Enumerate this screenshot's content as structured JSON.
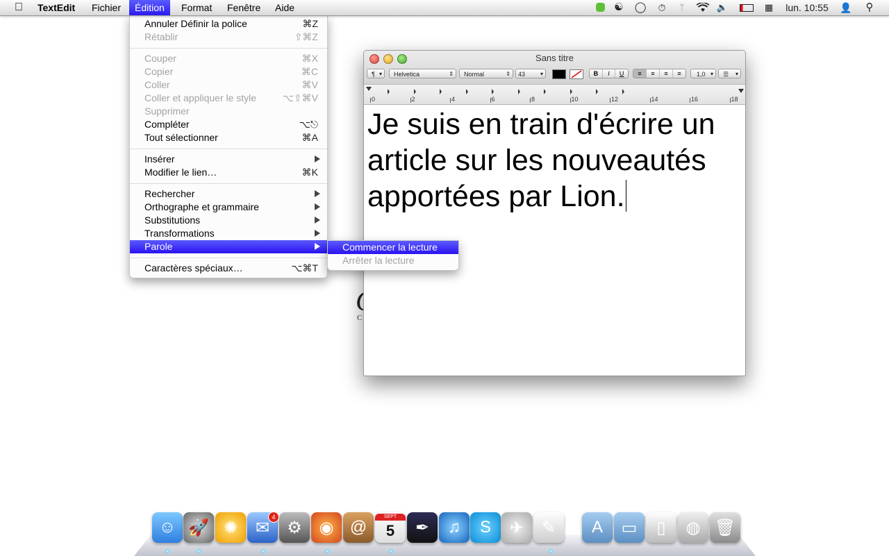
{
  "menubar": {
    "app_name": "TextEdit",
    "menus": [
      "Fichier",
      "Édition",
      "Format",
      "Fenêtre",
      "Aide"
    ],
    "clock": "lun. 10:55"
  },
  "edit_menu": {
    "groups": [
      [
        {
          "label": "Annuler Définir la police",
          "shortcut": "⌘Z",
          "enabled": true
        },
        {
          "label": "Rétablir",
          "shortcut": "⇧⌘Z",
          "enabled": false
        }
      ],
      [
        {
          "label": "Couper",
          "shortcut": "⌘X",
          "enabled": false
        },
        {
          "label": "Copier",
          "shortcut": "⌘C",
          "enabled": false
        },
        {
          "label": "Coller",
          "shortcut": "⌘V",
          "enabled": false
        },
        {
          "label": "Coller et appliquer le style",
          "shortcut": "⌥⇧⌘V",
          "enabled": false
        },
        {
          "label": "Supprimer",
          "shortcut": "",
          "enabled": false
        },
        {
          "label": "Compléter",
          "shortcut": "⌥⎋",
          "enabled": true
        },
        {
          "label": "Tout sélectionner",
          "shortcut": "⌘A",
          "enabled": true
        }
      ],
      [
        {
          "label": "Insérer",
          "submenu": true,
          "enabled": true
        },
        {
          "label": "Modifier le lien…",
          "shortcut": "⌘K",
          "enabled": true
        }
      ],
      [
        {
          "label": "Rechercher",
          "submenu": true,
          "enabled": true
        },
        {
          "label": "Orthographe et grammaire",
          "submenu": true,
          "enabled": true
        },
        {
          "label": "Substitutions",
          "submenu": true,
          "enabled": true
        },
        {
          "label": "Transformations",
          "submenu": true,
          "enabled": true
        },
        {
          "label": "Parole",
          "submenu": true,
          "enabled": true,
          "highlighted": true
        }
      ],
      [
        {
          "label": "Caractères spéciaux…",
          "shortcut": "⌥⌘T",
          "enabled": true
        }
      ]
    ]
  },
  "speech_submenu": {
    "items": [
      {
        "label": "Commencer la lecture",
        "enabled": true,
        "highlighted": true
      },
      {
        "label": "Arrêter la lecture",
        "enabled": false
      }
    ]
  },
  "window": {
    "title": "Sans titre",
    "toolbar": {
      "paragraph": "¶",
      "font": "Helvetica",
      "style": "Normal",
      "size": "43",
      "bold": "B",
      "italic": "I",
      "underline": "U",
      "spacing": "1,0",
      "text_color": "#000000"
    },
    "ruler_numbers": [
      "0",
      "2",
      "4",
      "6",
      "8",
      "10",
      "12",
      "14",
      "16",
      "18"
    ],
    "body_text": "Je suis en train d'écrire un article sur les nouveautés apportées par Lion."
  },
  "dock": {
    "mail_badge": "4",
    "calendar_day": "5",
    "calendar_month": "SEPT"
  }
}
